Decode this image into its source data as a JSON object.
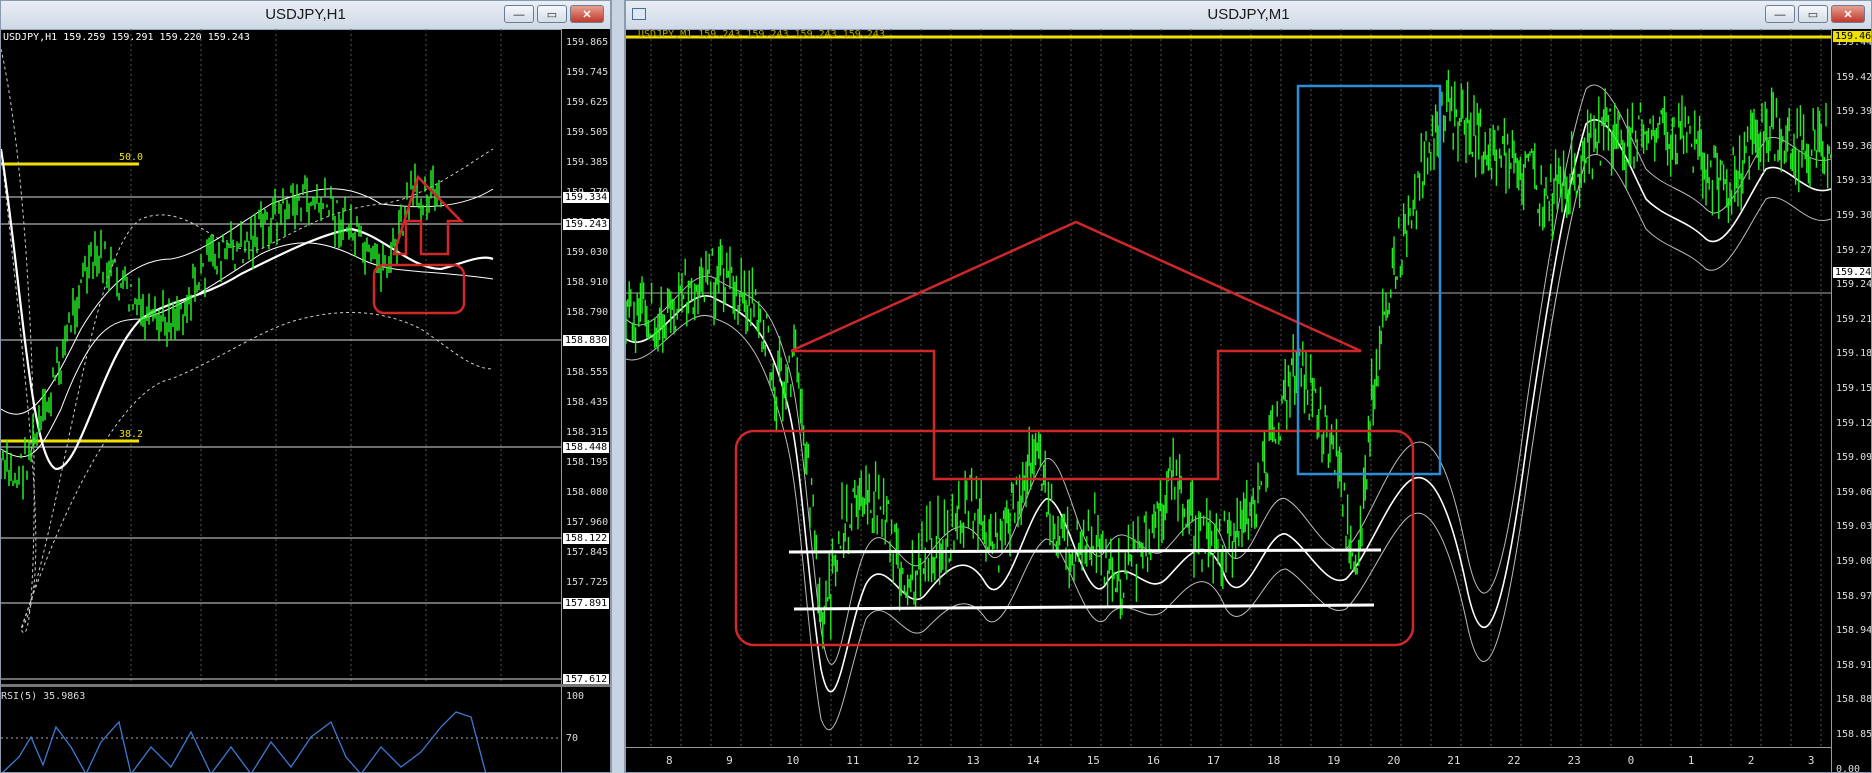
{
  "left_window": {
    "title": "USDJPY,H1",
    "info_line": "USDJPY,H1  159.259 159.291 159.220 159.243",
    "price_labels": [
      "159.865",
      "159.745",
      "159.625",
      "159.505",
      "159.385",
      "159.270",
      "159.150",
      "159.030",
      "158.910",
      "158.790",
      "158.675",
      "158.555",
      "158.435",
      "158.315",
      "158.195",
      "158.080",
      "157.960",
      "157.845",
      "157.725"
    ],
    "price_tags": [
      "159.334",
      "159.243",
      "158.830",
      "158.448",
      "158.122",
      "157.891",
      "157.612"
    ],
    "fib_labels": [
      "50.0",
      "38.2"
    ],
    "rsi_label": "RSI(5) 35.9863",
    "rsi_levels": [
      "100",
      "70"
    ],
    "buttons": {
      "minimize": "—",
      "restore": "▭",
      "close": "✕"
    }
  },
  "right_window": {
    "title": "USDJPY,M1",
    "info_line": "USDJPY,M1  159.243 159.243 159.243 159.243",
    "price_labels": [
      "159.445",
      "159.425",
      "159.393",
      "159.365",
      "159.335",
      "159.305",
      "159.275",
      "159.245",
      "159.215",
      "159.185",
      "159.155",
      "159.125",
      "159.095",
      "159.065",
      "159.035",
      "159.005",
      "158.975",
      "158.945",
      "158.915",
      "158.885",
      "158.855",
      "0.00"
    ],
    "price_tags": [
      "159.465",
      "159.243"
    ],
    "time_labels": [
      "8",
      "9",
      "10",
      "11",
      "12",
      "13",
      "14",
      "15",
      "16",
      "17",
      "18",
      "19",
      "20",
      "21",
      "22",
      "23",
      "0",
      "1",
      "2",
      "3"
    ],
    "buttons": {
      "minimize": "—",
      "restore": "▭",
      "close": "✕"
    }
  },
  "colors": {
    "candle": "#22ee22",
    "annotation_red": "#d02828",
    "annotation_blue": "#2a8fd8",
    "fib_yellow": "#f0e000",
    "rsi_blue": "#3a7bd5"
  }
}
